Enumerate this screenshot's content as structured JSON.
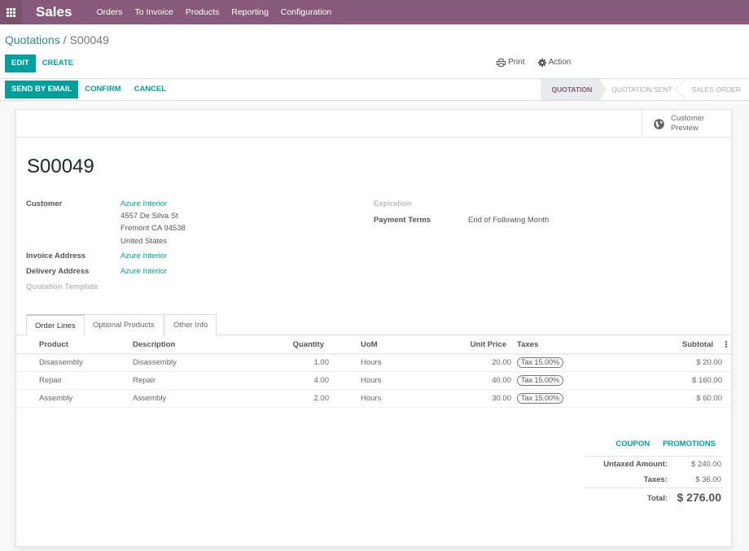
{
  "navbar": {
    "app_name": "Sales",
    "menu": [
      "Orders",
      "To Invoice",
      "Products",
      "Reporting",
      "Configuration"
    ],
    "color": "#875a7b"
  },
  "breadcrumb": {
    "parent": "Quotations",
    "separator": "/",
    "current": "S00049"
  },
  "toolbar": {
    "edit_label": "EDIT",
    "create_label": "CREATE",
    "print_label": "Print",
    "action_label": "Action"
  },
  "status_buttons": {
    "send_email_label": "SEND BY EMAIL",
    "confirm_label": "CONFIRM",
    "cancel_label": "CANCEL"
  },
  "stages": [
    {
      "label": "QUOTATION",
      "active": true
    },
    {
      "label": "QUOTATION SENT",
      "active": false
    },
    {
      "label": "SALES ORDER",
      "active": false
    }
  ],
  "smart_button": {
    "line1": "Customer",
    "line2": "Preview"
  },
  "record": {
    "name": "S00049",
    "customer_label": "Customer",
    "customer": "Azure Interior",
    "address_line1": "4557 De Silva St",
    "address_line2": "Fremont CA 94538",
    "address_line3": "United States",
    "invoice_address_label": "Invoice Address",
    "invoice_address": "Azure Interior",
    "delivery_address_label": "Delivery Address",
    "delivery_address": "Azure Interior",
    "quotation_template_label": "Quotation Template",
    "expiration_label": "Expiration",
    "payment_terms_label": "Payment Terms",
    "payment_terms": "End of Following Month"
  },
  "tabs": [
    {
      "label": "Order Lines",
      "active": true
    },
    {
      "label": "Optional Products",
      "active": false
    },
    {
      "label": "Other Info",
      "active": false
    }
  ],
  "order_lines": {
    "columns": [
      "Product",
      "Description",
      "Quantity",
      "UoM",
      "Unit Price",
      "Taxes",
      "Subtotal"
    ],
    "rows": [
      {
        "product": "Disassembly",
        "description": "Disassembly",
        "quantity": "1.00",
        "uom": "Hours",
        "unit_price": "20.00",
        "taxes": "Tax 15.00%",
        "subtotal": "$ 20.00"
      },
      {
        "product": "Repair",
        "description": "Repair",
        "quantity": "4.00",
        "uom": "Hours",
        "unit_price": "40.00",
        "taxes": "Tax 15.00%",
        "subtotal": "$ 160.00"
      },
      {
        "product": "Assembly",
        "description": "Assembly",
        "quantity": "2.00",
        "uom": "Hours",
        "unit_price": "30.00",
        "taxes": "Tax 15.00%",
        "subtotal": "$ 60.00"
      }
    ]
  },
  "actions": {
    "coupon_label": "COUPON",
    "promotions_label": "PROMOTIONS"
  },
  "totals": {
    "untaxed_label": "Untaxed Amount:",
    "untaxed": "$ 240.00",
    "taxes_label": "Taxes:",
    "taxes": "$ 36.00",
    "total_label": "Total:",
    "total": "$ 276.00"
  }
}
